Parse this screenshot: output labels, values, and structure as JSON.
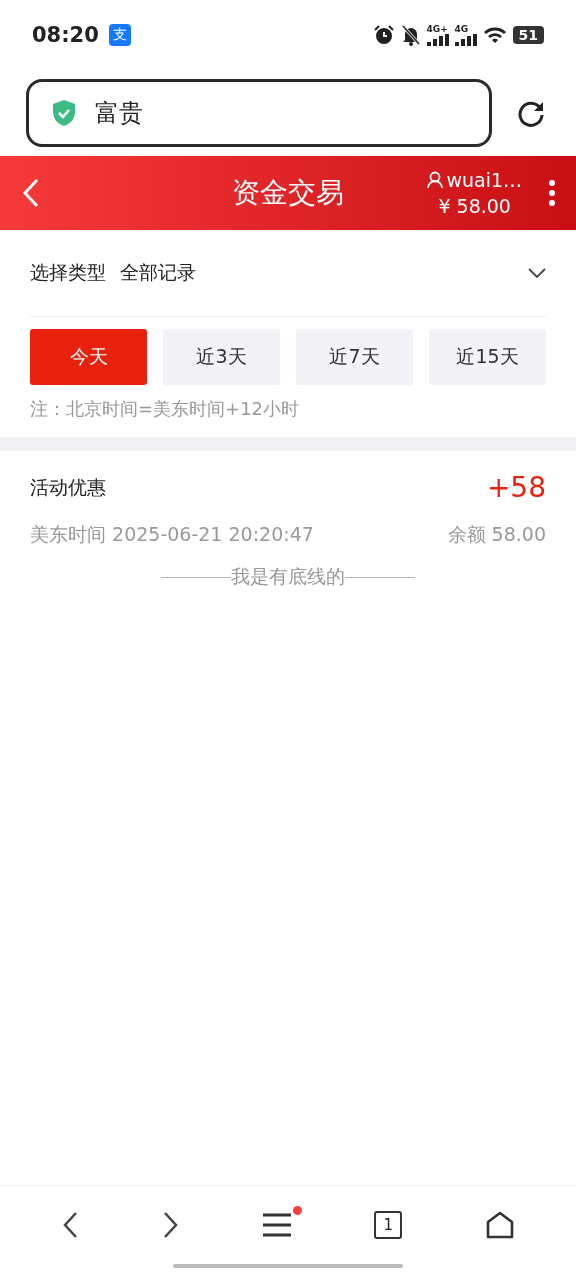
{
  "status_bar": {
    "time": "08:20",
    "app_badge": "支",
    "signal_labels": [
      "4G+",
      "4G"
    ],
    "battery": "51"
  },
  "address_bar": {
    "value": "富贵"
  },
  "header": {
    "title": "资金交易",
    "username": "wuai1…",
    "balance": "¥ 58.00"
  },
  "filter": {
    "label": "选择类型",
    "value": "全部记录"
  },
  "tabs": [
    {
      "label": "今天",
      "selected": true
    },
    {
      "label": "近3天",
      "selected": false
    },
    {
      "label": "近7天",
      "selected": false
    },
    {
      "label": "近15天",
      "selected": false
    }
  ],
  "note": "注：北京时间=美东时间+12小时",
  "records": [
    {
      "title": "活动优惠",
      "amount": "+58",
      "time": "美东时间 2025-06-21 20:20:47",
      "balance": "余额 58.00"
    }
  ],
  "end_text": "我是有底线的",
  "bottom_nav": {
    "tab_count": "1",
    "menu_notification": true
  }
}
